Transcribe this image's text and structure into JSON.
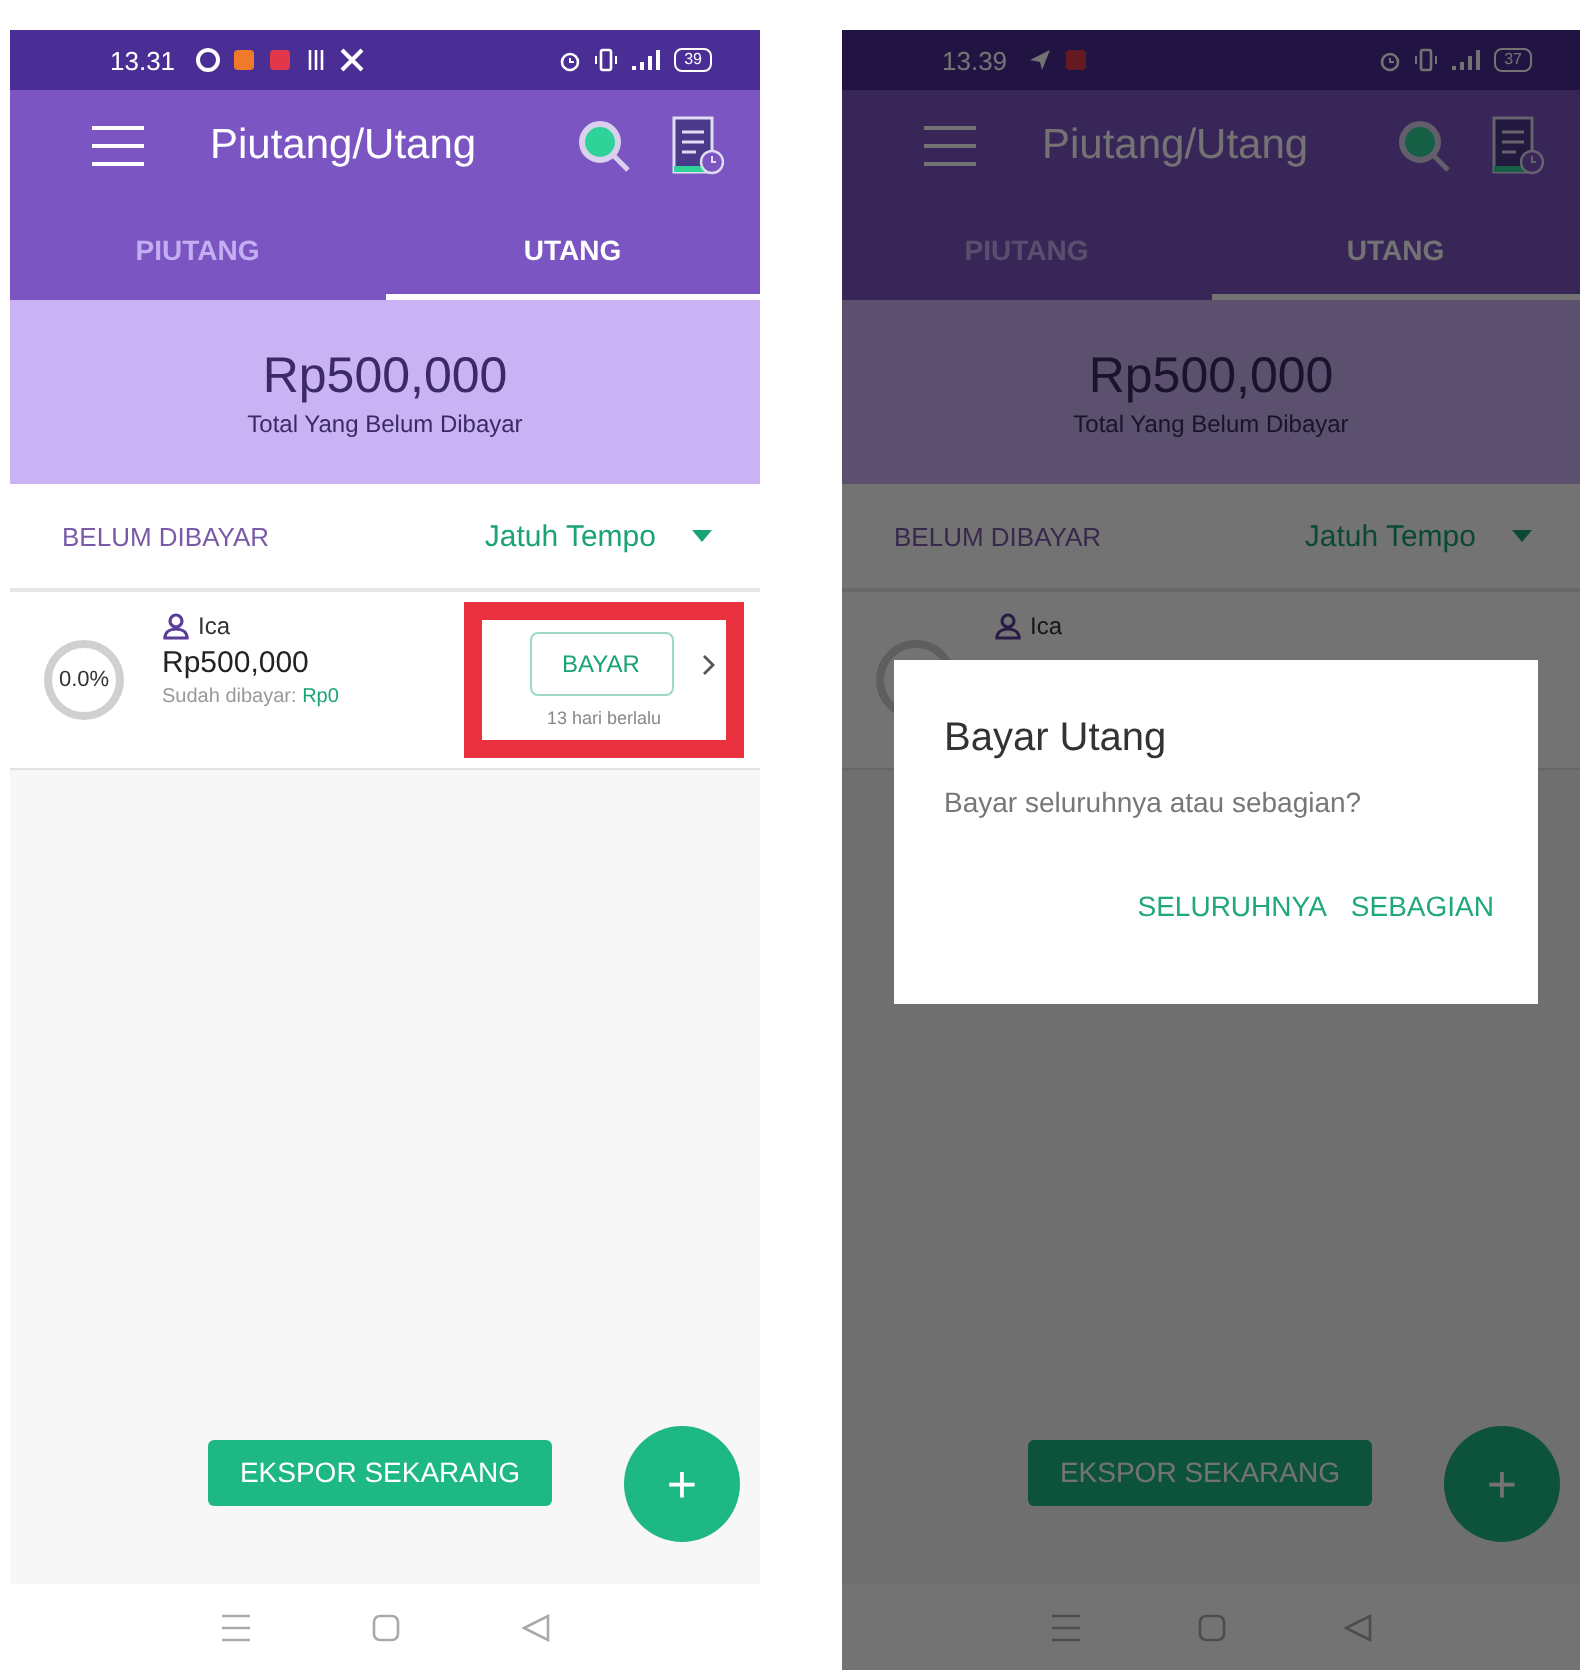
{
  "screens": [
    {
      "dimmed": false,
      "status_bar": {
        "time": "13.31",
        "notification_icons": [
          {
            "kind": "round"
          },
          {
            "kind": "bag"
          },
          {
            "kind": "game"
          },
          {
            "kind": "striped"
          },
          {
            "kind": "cross"
          }
        ],
        "battery": "39"
      },
      "app_bar": {
        "title": "Piutang/Utang"
      },
      "tabs": [
        {
          "label": "PIUTANG",
          "selected": false
        },
        {
          "label": "UTANG",
          "selected": true
        }
      ],
      "summary": {
        "amount": "Rp500,000",
        "label": "Total Yang Belum Dibayar"
      },
      "filter": {
        "status": "BELUM DIBAYAR",
        "sort": "Jatuh Tempo"
      },
      "entries": [
        {
          "name": "Ica",
          "level": 0,
          "progress": "0.0%",
          "amount": "Rp500,000",
          "paid_label": "Sudah dibayar:",
          "paid": "Rp0",
          "pay_button": "BAYAR",
          "age": "13 hari berlalu",
          "highlighted": true
        }
      ],
      "export_button": "EKSPOR SEKARANG",
      "fab": "+"
    },
    {
      "dimmed": true,
      "status_bar": {
        "time": "13.39",
        "notification_icons": [
          {
            "kind": "send"
          },
          {
            "kind": "game"
          }
        ],
        "battery": "37"
      },
      "app_bar": {
        "title": "Piutang/Utang"
      },
      "tabs": [
        {
          "label": "PIUTANG",
          "selected": false
        },
        {
          "label": "UTANG",
          "selected": true
        }
      ],
      "summary": {
        "amount": "Rp500,000",
        "label": "Total Yang Belum Dibayar"
      },
      "filter": {
        "status": "BELUM DIBAYAR",
        "sort": "Jatuh Tempo"
      },
      "entries": [
        {
          "name": "Ica",
          "level": 0,
          "highlighted": false
        }
      ],
      "export_button": "EKSPOR SEKARANG",
      "fab": "+",
      "dialog": {
        "title": "Bayar Utang",
        "message": "Bayar seluruhnya atau sebagian?",
        "buttons": [
          "SELURUHNYA",
          "SEBAGIAN"
        ]
      }
    }
  ]
}
